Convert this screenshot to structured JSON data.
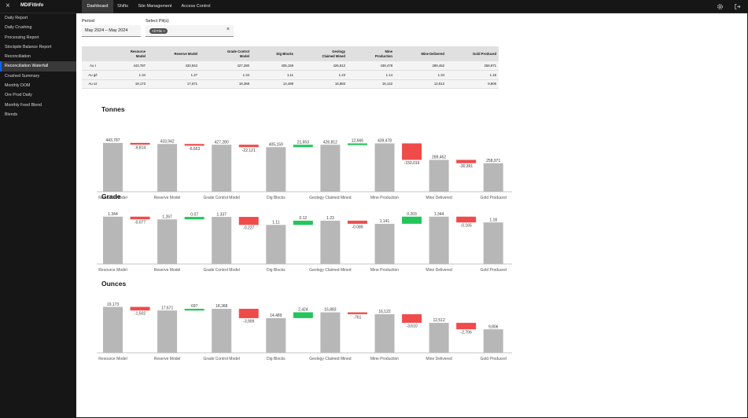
{
  "app": {
    "title": "MDIFitInfo",
    "close_icon": "close-icon"
  },
  "nav": {
    "tabs": [
      "Dashboard",
      "Shifts",
      "Site Management",
      "Access Control"
    ],
    "active_tab": "Dashboard",
    "icons": [
      "settings-icon",
      "logout-icon"
    ]
  },
  "sidebar": {
    "items": [
      {
        "label": "Daily Report"
      },
      {
        "label": "Daily Crushing"
      },
      {
        "label": "Processing Report"
      },
      {
        "label": "Stockpile Balance Report"
      },
      {
        "label": "Reconciliation"
      },
      {
        "label": "Reconciliation Waterfall"
      },
      {
        "label": "Crushed Summary"
      },
      {
        "label": "Monthly DOM"
      },
      {
        "label": "Ore Prod Daily"
      },
      {
        "label": "Monthly Feed Blend"
      },
      {
        "label": "Blends"
      }
    ],
    "active": "Reconciliation Waterfall"
  },
  "filters": {
    "period_label": "Period",
    "period_value": "May 2024 – May 2024",
    "pits_label": "Select Pit(s)",
    "pits_tag": "All Pits",
    "tag_close": "×",
    "clear": "×"
  },
  "table": {
    "headers": [
      "",
      "Resource\nModel",
      "Reserve Model",
      "Grade Control\nModel",
      "Dig Blocks",
      "Geology\nClaimed Mined",
      "Mine\nProduction",
      "Mine Delivered",
      "Gold Produced"
    ],
    "rows": [
      [
        "Au t",
        "443,787",
        "433,942",
        "427,280",
        "405,159",
        "426,812",
        "439,478",
        "289,462",
        "258,971"
      ],
      [
        "Au g/t",
        "1.34",
        "1.27",
        "1.34",
        "1.11",
        "1.23",
        "1.14",
        "1.34",
        "1.18"
      ],
      [
        "Au oz",
        "19,173",
        "17,671",
        "18,368",
        "14,489",
        "16,883",
        "16,122",
        "12,512",
        "9,806"
      ]
    ]
  },
  "chart_data": [
    {
      "type": "bar",
      "title": "Tonnes",
      "categories": [
        "Resource Model",
        "Reserve Model",
        "Grade Control Model",
        "Dig Blocks",
        "Geology Claimed Mined",
        "Mine Production",
        "Mine Delivered",
        "Gold Produced"
      ],
      "totals": [
        443787,
        433942,
        427280,
        405159,
        426812,
        439478,
        289462,
        258971
      ],
      "total_labels": [
        "443,787",
        "433,942",
        "427,280",
        "405,159",
        "426,812",
        "439,478",
        "289,462",
        "258,971"
      ],
      "deltas": [
        -9814,
        -6663,
        -22121,
        21653,
        12666,
        -150016,
        -30391
      ],
      "delta_labels": [
        "-9,814",
        "-6,663",
        "-22,121",
        "21,653",
        "12,666",
        "-150,016",
        "-30,391"
      ],
      "ymax": 500000,
      "colors": {
        "total": "#b7b7b7",
        "increase": "#24c55b",
        "decrease": "#ef4b4b"
      }
    },
    {
      "type": "bar",
      "title": "Grade",
      "categories": [
        "Resource Model",
        "Reserve Model",
        "Grade Control Model",
        "Dig Blocks",
        "Geology Claimed Mined",
        "Mine Production",
        "Mine Delivered",
        "Gold Produced"
      ],
      "totals": [
        1.344,
        1.267,
        1.337,
        1.11,
        1.23,
        1.141,
        1.344,
        1.18
      ],
      "total_labels": [
        "1.344",
        "1.267",
        "1.337",
        "1.11",
        "1.23",
        "1.141",
        "1.344",
        "1.18"
      ],
      "deltas": [
        -0.077,
        0.07,
        -0.227,
        0.12,
        -0.089,
        0.203,
        -0.165
      ],
      "delta_labels": [
        "-0.077",
        "0.07",
        "-0.227",
        "0.12",
        "-0.089",
        "0.203",
        "-0.165"
      ],
      "ymax": 1.45,
      "colors": {
        "total": "#b7b7b7",
        "increase": "#24c55b",
        "decrease": "#ef4b4b"
      }
    },
    {
      "type": "bar",
      "title": "Ounces",
      "categories": [
        "Resource Model",
        "Reserve Model",
        "Grade Control Model",
        "Dig Blocks",
        "Geology Claimed Mined",
        "Mine Production",
        "Mine Delivered",
        "Gold Produced"
      ],
      "totals": [
        19173,
        17671,
        18368,
        14489,
        16883,
        16122,
        12512,
        9806
      ],
      "total_labels": [
        "19,173",
        "17,671",
        "18,368",
        "14,489",
        "16,883",
        "16,122",
        "12,512",
        "9,806"
      ],
      "deltas": [
        -1502,
        697,
        -3909,
        2424,
        -761,
        -3610,
        -2706
      ],
      "delta_labels": [
        "-1,502",
        "697",
        "-3,909",
        "2,424",
        "-761",
        "-3,610",
        "-2,706"
      ],
      "ymax": 21000,
      "colors": {
        "total": "#b7b7b7",
        "increase": "#24c55b",
        "decrease": "#ef4b4b"
      }
    }
  ]
}
